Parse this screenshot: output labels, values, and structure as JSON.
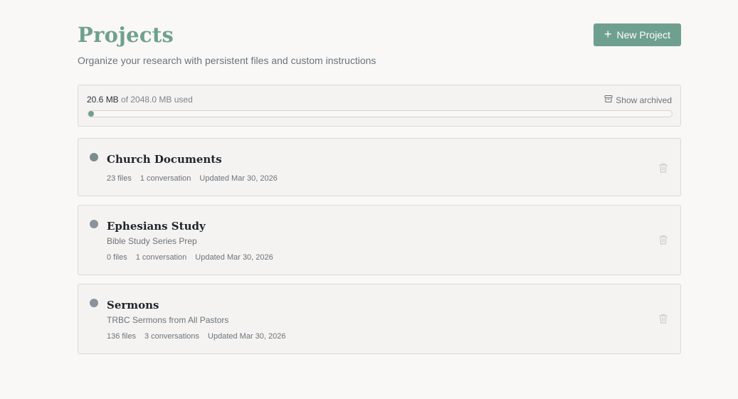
{
  "header": {
    "title": "Projects",
    "subtitle": "Organize your research with persistent files and custom instructions",
    "new_project_icon": "plus-icon",
    "new_project_label": "New Project"
  },
  "storage": {
    "used": "20.6 MB",
    "of_total": " of 2048.0 MB used",
    "used_fraction": 0.01,
    "archive_icon": "archive-icon",
    "show_archived_label": "Show archived"
  },
  "projects": [
    {
      "name": "Church Documents",
      "description": "",
      "files": "23 files",
      "conversations": "1 conversation",
      "updated": "Updated Mar 30, 2026",
      "dot_color": "#7b8d8e",
      "delete_icon": "trash-icon"
    },
    {
      "name": "Ephesians Study",
      "description": "Bible Study Series Prep",
      "files": "0 files",
      "conversations": "1 conversation",
      "updated": "Updated Mar 30, 2026",
      "dot_color": "#8a939c",
      "delete_icon": "trash-icon"
    },
    {
      "name": "Sermons",
      "description": "TRBC Sermons from All Pastors",
      "files": "136 files",
      "conversations": "3 conversations",
      "updated": "Updated Mar 30, 2026",
      "dot_color": "#8a939c",
      "delete_icon": "trash-icon"
    }
  ],
  "colors": {
    "accent": "#6fa08f",
    "background": "#f9f8f6",
    "card": "#f5f3f1",
    "border": "#dcd9d5"
  }
}
